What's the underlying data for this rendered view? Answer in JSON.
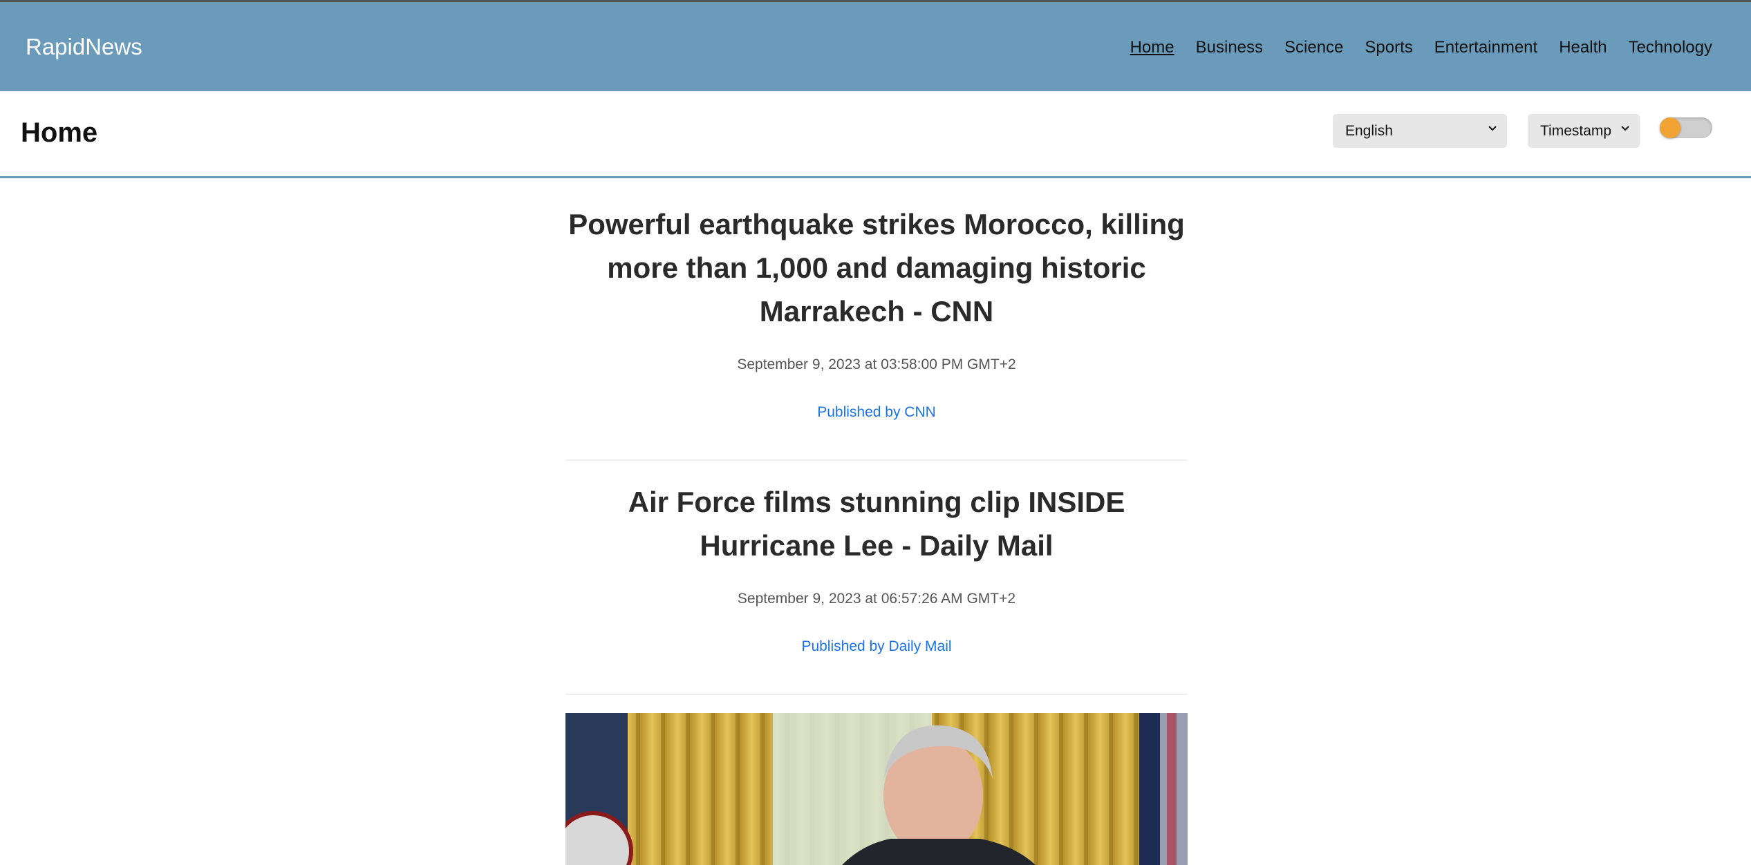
{
  "header": {
    "brand": "RapidNews",
    "nav": [
      "Home",
      "Business",
      "Science",
      "Sports",
      "Entertainment",
      "Health",
      "Technology"
    ],
    "active_nav": "Home"
  },
  "subheader": {
    "title": "Home",
    "language": "English",
    "sort": "Timestamp",
    "theme_toggle_on": false
  },
  "articles": [
    {
      "title": "Powerful earthquake strikes Morocco, killing more than 1,000 and damaging historic Marrakech - CNN",
      "time": "September 9, 2023 at 03:58:00 PM GMT+2",
      "publisher": "Published by CNN"
    },
    {
      "title": "Air Force films stunning clip INSIDE Hurricane Lee - Daily Mail",
      "time": "September 9, 2023 at 06:57:26 AM GMT+2",
      "publisher": "Published by Daily Mail"
    }
  ],
  "colors": {
    "topbar": "#6a9bbb",
    "accent_link": "#1a73e8",
    "toggle_knob": "#f0a232"
  },
  "icons": {
    "select_chevron": "chevron-down-icon"
  }
}
